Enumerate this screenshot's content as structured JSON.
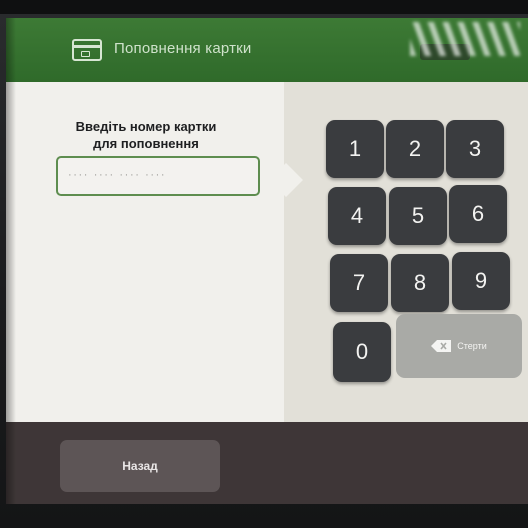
{
  "header": {
    "title": "Поповнення картки",
    "card_icon": "card-icon"
  },
  "prompt": {
    "line1": "Введіть номер картки",
    "line2": "для поповнення"
  },
  "card_input": {
    "value": "",
    "placeholder": "····  ····  ····  ····"
  },
  "keypad": {
    "keys": [
      "1",
      "2",
      "3",
      "4",
      "5",
      "6",
      "7",
      "8",
      "9",
      "0"
    ],
    "erase_label": "Стерти",
    "erase_icon": "backspace-icon"
  },
  "footer": {
    "back_label": "Назад"
  },
  "colors": {
    "header_green": "#3d7a35",
    "input_border": "#5e8d4f",
    "key_dark": "#3a3c3f",
    "erase_key": "#a9aaa6",
    "bottom_bar": "#3e3637"
  }
}
